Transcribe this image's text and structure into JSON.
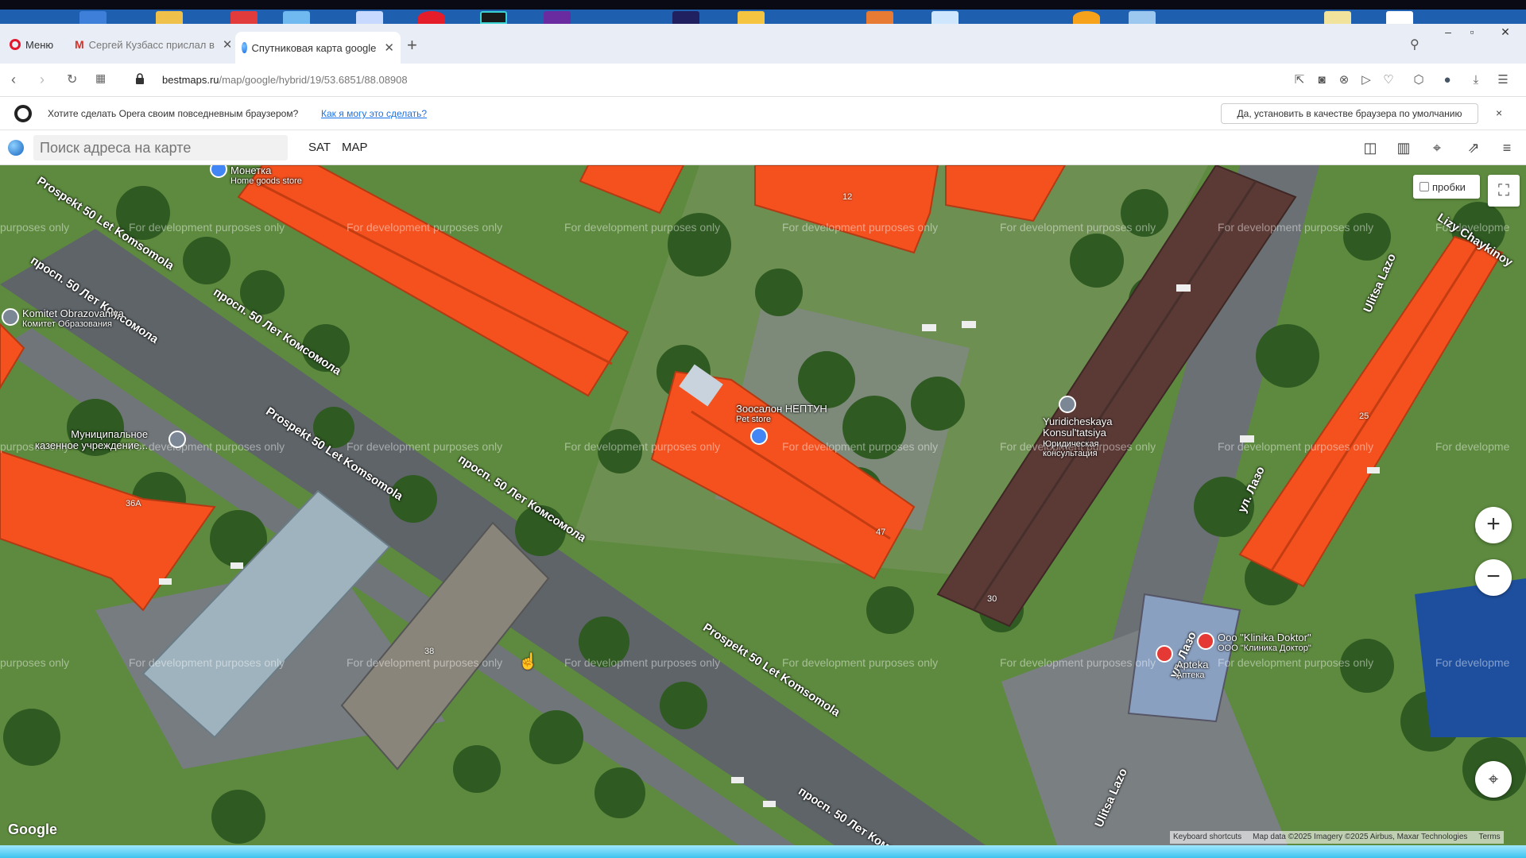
{
  "browser": {
    "tabs": [
      {
        "label": "Меню",
        "icon": "opera-icon"
      },
      {
        "label": "Сергей Кузбасс прислал в",
        "icon": "gmail-icon"
      },
      {
        "label": "Спутниковая карта google",
        "icon": "globe-icon"
      }
    ],
    "url_host": "bestmaps.ru",
    "url_path": "/map/google/hybrid/19/53.6851/88.08908"
  },
  "notice": {
    "text": "Хотите сделать Opera своим повседневным браузером?",
    "link": "Как я могу это сделать?",
    "button": "Да, установить в качестве браузера по умолчанию",
    "close": "×"
  },
  "map_toolbar": {
    "search_placeholder": "Поиск адреса на карте",
    "sat": "SAT",
    "map": "MAP"
  },
  "map": {
    "watermark": "For development purposes only",
    "watermark_partial": "purposes only",
    "watermark_right": "For developme",
    "traffic_label": "пробки",
    "google": "Google",
    "attribution": [
      "Keyboard shortcuts",
      "Map data ©2025 Imagery ©2025 Airbus, Maxar Technologies",
      "Terms"
    ],
    "road_labels": [
      "Prospekt 50 Let Komsomola",
      "просп. 50 Лет Комсомола",
      "просп. 50 Лет Комсомола",
      "Prospekt 50 Let Komsomola",
      "просп. 50 Лет Комсомола",
      "Prospekt 50 Let Komsomola",
      "просп. 50 Лет Комсом",
      "Ulitsa Lazo",
      "ул. Лазо",
      "ул. Лазо",
      "Ulitsa Lazo",
      "Lizy Chaykinoy"
    ],
    "pois": [
      {
        "name": "Монетка",
        "sub": "Home goods store"
      },
      {
        "name": "Komitet Obrazovaniya",
        "sub": "Комитет Образования"
      },
      {
        "name": "Муниципальное",
        "sub": "казенное учреждение..."
      },
      {
        "name": "Зоосалон НЕПТУН",
        "sub": "Pet store"
      },
      {
        "name": "Yuridicheskaya Konsul'tatsiya",
        "sub": "Юридическая консультация"
      },
      {
        "name": "Ooo \"Klinika Doktor\"",
        "sub": "ООО \"Клиника Доктор\""
      },
      {
        "name": "Apteka",
        "sub": "Аптека"
      }
    ],
    "house_numbers": [
      "12",
      "36А",
      "25",
      "47",
      "38",
      "30",
      "6"
    ]
  },
  "colors": {
    "roof_orange": "#f4511e",
    "roof_brown": "#5b3a36",
    "grass": "#5d8a3e",
    "asphalt": "#5e6468"
  }
}
